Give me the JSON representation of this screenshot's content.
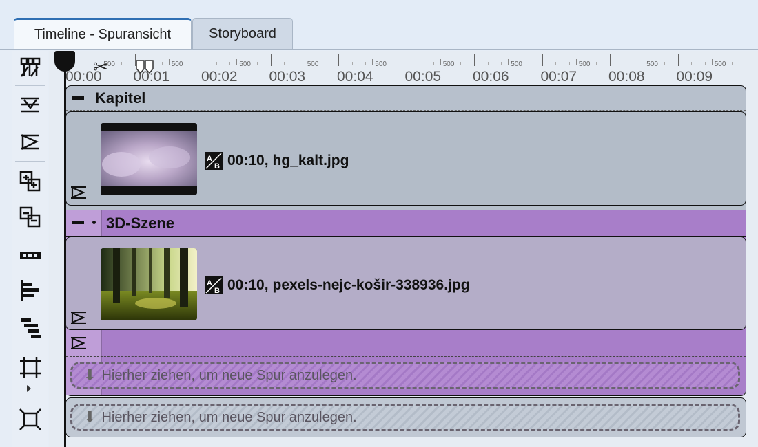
{
  "tabs": [
    {
      "label": "Timeline - Spuransicht",
      "active": true
    },
    {
      "label": "Storyboard",
      "active": false
    }
  ],
  "toolbar": {
    "icons": [
      "timeline-split-icon",
      "collapse-track-icon",
      "track-flag-icon",
      "add-track-icon",
      "remove-track-icon",
      "film-strip-icon",
      "align-left-icon",
      "align-right-icon",
      "crop-frame-icon",
      "fit-frame-icon"
    ]
  },
  "ruler": {
    "labels": [
      "00:00",
      "00:01",
      "00:02",
      "00:03",
      "00:04",
      "00:05",
      "00:06",
      "00:07",
      "00:08",
      "00:09"
    ],
    "minor_label": "500"
  },
  "kapitel": {
    "title": "Kapitel",
    "clip": {
      "duration": "00:10,",
      "filename": "hg_kalt.jpg"
    }
  },
  "szene": {
    "title": "3D-Szene",
    "clip": {
      "duration": "00:10,",
      "filename": "pexels-nejc-košir-338936.jpg"
    }
  },
  "dropzones": {
    "inner": "Hierher ziehen, um neue Spur anzulegen.",
    "outer": "Hierher ziehen, um neue Spur anzulegen."
  },
  "colors": {
    "kapitel_bg": "#b7c0cc",
    "szene_bg": "#a87ec9",
    "accent": "#2f6fb3"
  }
}
